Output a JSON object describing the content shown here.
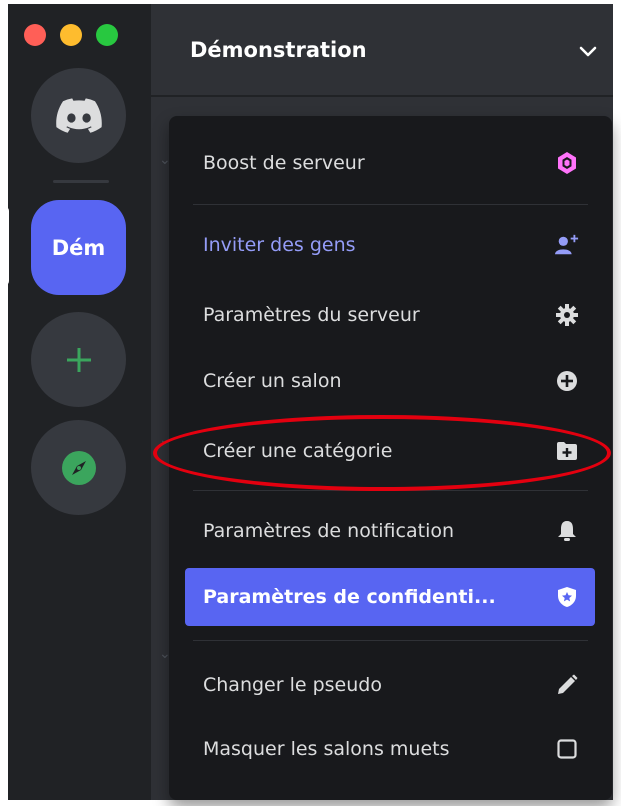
{
  "window": {
    "controls": [
      "close",
      "minimize",
      "zoom"
    ]
  },
  "server_rail": {
    "home_icon": "discord-logo-icon",
    "server_abbrev": "Dém",
    "add_icon": "plus-icon",
    "explore_icon": "compass-icon"
  },
  "header": {
    "title": "Démonstration",
    "chevron_icon": "chevron-down-icon"
  },
  "menu": {
    "items": [
      {
        "label": "Boost de serveur",
        "icon": "boost-gem-icon"
      },
      {
        "label": "Inviter des gens",
        "icon": "add-person-icon"
      },
      {
        "label": "Paramètres du serveur",
        "icon": "gear-icon"
      },
      {
        "label": "Créer un salon",
        "icon": "plus-circle-icon"
      },
      {
        "label": "Créer une catégorie",
        "icon": "folder-plus-icon"
      },
      {
        "label": "Paramètres de notification",
        "icon": "bell-icon"
      },
      {
        "label": "Paramètres de confidenti...",
        "icon": "shield-icon"
      },
      {
        "label": "Changer le pseudo",
        "icon": "pencil-icon"
      },
      {
        "label": "Masquer les salons muets",
        "icon": "checkbox-icon"
      }
    ]
  },
  "colors": {
    "blurple": "#5865f2",
    "invite_text": "#949cf7",
    "boost_pink": "#ff73fa",
    "green": "#3ba55d",
    "highlight_red": "#e3000f"
  }
}
